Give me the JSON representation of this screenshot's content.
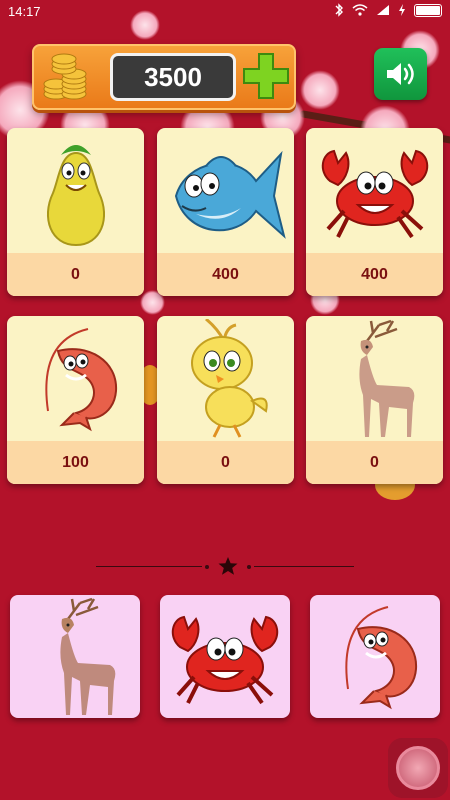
{
  "status_bar": {
    "time": "14:17"
  },
  "header": {
    "coins": "3500"
  },
  "cards": [
    {
      "name": "pear",
      "count": "0"
    },
    {
      "name": "fish",
      "count": "400"
    },
    {
      "name": "crab",
      "count": "400"
    },
    {
      "name": "shrimp",
      "count": "100"
    },
    {
      "name": "chick",
      "count": "0"
    },
    {
      "name": "deer",
      "count": "0"
    }
  ],
  "choices": [
    {
      "name": "deer"
    },
    {
      "name": "crab"
    },
    {
      "name": "shrimp"
    }
  ],
  "icons": {
    "coins": "coin-stack-icon",
    "add": "plus-icon",
    "sound": "speaker-icon",
    "floating": "circle-button-icon"
  },
  "colors": {
    "background": "#b3122a",
    "card": "#fbf3c5",
    "card_footer": "#fcd8a4",
    "choice": "#f9d2f4",
    "count_text": "#7a1010",
    "sound_button": "#1aa84b",
    "coin_panel": "#f39025"
  }
}
